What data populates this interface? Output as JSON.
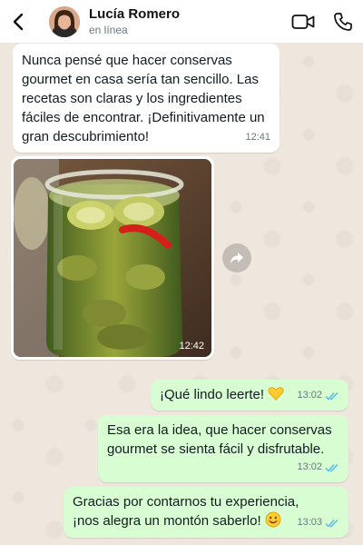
{
  "header": {
    "back_icon": "chevron-left-icon",
    "contact_name": "Lucía Romero",
    "status": "en línea",
    "video_icon": "video-camera-icon",
    "call_icon": "phone-icon"
  },
  "messages": [
    {
      "direction": "incoming",
      "type": "text",
      "text": "Nunca pensé que hacer conservas gourmet en casa sería tan sencillo. Las recetas son claras y los ingredientes fáciles de encontrar. ¡Definitivamente un gran descubrimiento!",
      "time": "12:41"
    },
    {
      "direction": "incoming",
      "type": "image",
      "image_subject": "jar of pickled cucumbers with red chili",
      "time": "12:42"
    },
    {
      "direction": "outgoing",
      "type": "text",
      "text": "¡Qué lindo leerte!",
      "emoji": "yellow-heart",
      "time": "13:02",
      "status": "read"
    },
    {
      "direction": "outgoing",
      "type": "text",
      "text": "Esa era la idea, que hacer conservas gourmet se sienta fácil y disfrutable.",
      "time": "13:02",
      "status": "read"
    },
    {
      "direction": "outgoing",
      "type": "text",
      "text": "Gracias por contarnos tu experiencia, ¡nos alegra un montón saberlo!",
      "emoji": "smiling-face",
      "time": "13:03",
      "status": "read"
    }
  ],
  "colors": {
    "incoming_bubble": "#ffffff",
    "outgoing_bubble": "#d9fdd3",
    "read_ticks": "#53bdeb",
    "wallpaper": "#efe7dd"
  }
}
